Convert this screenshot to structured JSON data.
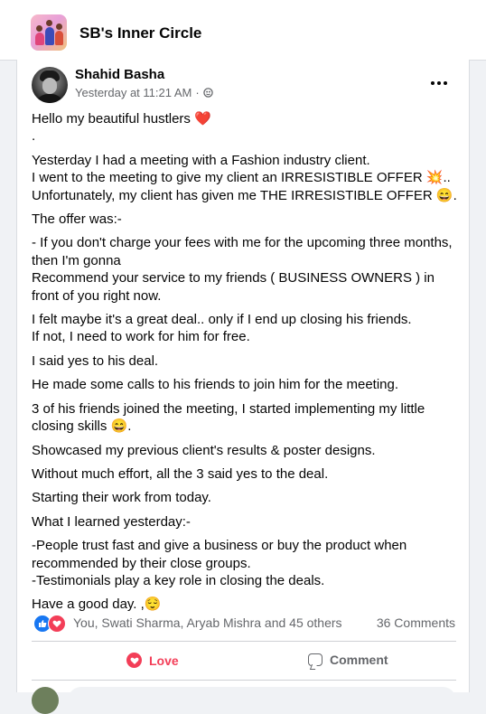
{
  "group": {
    "name": "SB's Inner Circle",
    "icon": "group-cover-thumbnail"
  },
  "post": {
    "author": "Shahid Basha",
    "timestamp": "Yesterday at 11:21 AM",
    "separator": "·",
    "privacy_icon": "globe-icon",
    "more_icon": "more-options-icon",
    "paragraphs": [
      "Hello my beautiful hustlers ❤️\n.",
      "Yesterday I had a meeting with a Fashion industry client.\nI went to the meeting to give my client an IRRESISTIBLE OFFER 💥..\nUnfortunately, my client has given me THE IRRESISTIBLE OFFER 😄.",
      "The offer was:-",
      "- If you don't charge your fees with me for the upcoming three months, then I'm gonna\nRecommend your service to my friends ( BUSINESS OWNERS ) in front of you right now.",
      "I felt maybe it's a great deal.. only if I end up closing his friends.\nIf not, I need to work for him for free.",
      "I said yes to his deal.",
      "He made some calls to his friends to join him for the meeting.",
      "3 of his friends joined the meeting, I started implementing my little closing skills 😄.",
      "Showcased my previous client's results & poster designs.",
      "Without much effort, all the 3 said yes to the deal.",
      "Starting their work from today.",
      "What I learned yesterday:-",
      "-People trust fast and give a business or buy the product when recommended by their close groups.\n-Testimonials play a key role in closing the deals.",
      "Have a good day. ,😌"
    ]
  },
  "reactions": {
    "icons": [
      "like-icon",
      "love-icon"
    ],
    "names": "You, Swati Sharma, Aryab Mishra and 45 others",
    "comments": "36 Comments"
  },
  "actions": {
    "love_label": "Love",
    "comment_label": "Comment"
  },
  "colors": {
    "love": "#f33e58",
    "like": "#1877f2",
    "secondary_text": "#65676b",
    "background": "#f0f2f5"
  }
}
